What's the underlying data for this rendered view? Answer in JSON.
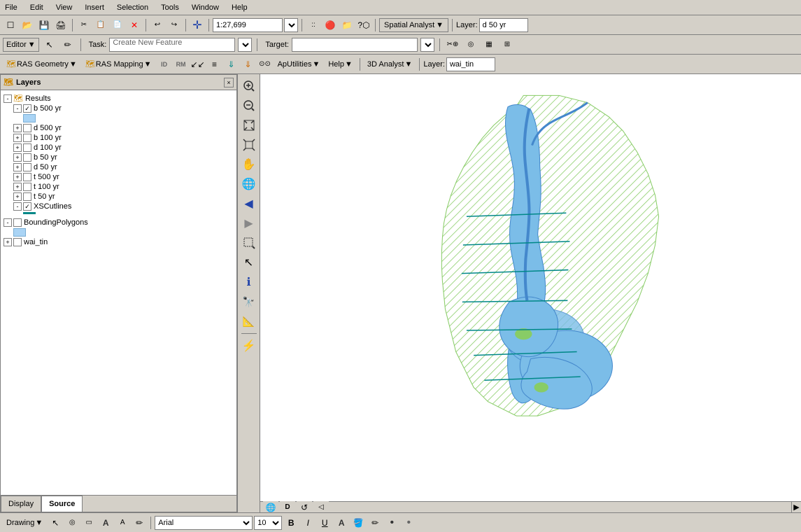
{
  "menubar": {
    "items": [
      "File",
      "Edit",
      "View",
      "Insert",
      "Selection",
      "Tools",
      "Window",
      "Help"
    ]
  },
  "toolbar1": {
    "scale": "1:27,699",
    "spatial_analyst": "Spatial Analyst",
    "layer_label": "Layer:",
    "layer_value": "d 50 yr"
  },
  "toolbar2": {
    "editor_label": "Editor",
    "task_label": "Task:",
    "task_value": "Create New Feature",
    "target_label": "Target:"
  },
  "ras_toolbar": {
    "ras_geometry": "RAS Geometry",
    "ras_mapping": "RAS Mapping",
    "ap_utilities": "ApUtilities",
    "help": "Help",
    "analyst_3d": "3D Analyst",
    "layer_label": "Layer:",
    "layer_value": "wai_tin"
  },
  "layers_panel": {
    "title": "Layers",
    "close_label": "×",
    "groups": [
      {
        "name": "Results",
        "expanded": true,
        "children": [
          {
            "name": "b 500 yr",
            "checked": true,
            "expanded": true,
            "swatch_color": "#aad4f5",
            "indent": 1
          },
          {
            "name": "d 500 yr",
            "checked": false,
            "expanded": false,
            "indent": 1
          },
          {
            "name": "b 100 yr",
            "checked": false,
            "expanded": false,
            "indent": 1
          },
          {
            "name": "d 100 yr",
            "checked": false,
            "expanded": false,
            "indent": 1
          },
          {
            "name": "b 50 yr",
            "checked": false,
            "expanded": false,
            "indent": 1
          },
          {
            "name": "d 50 yr",
            "checked": false,
            "expanded": false,
            "indent": 1
          },
          {
            "name": "t 500 yr",
            "checked": false,
            "expanded": false,
            "indent": 1
          },
          {
            "name": "t 100 yr",
            "checked": false,
            "expanded": false,
            "indent": 1
          },
          {
            "name": "t 50 yr",
            "checked": false,
            "expanded": false,
            "indent": 1
          },
          {
            "name": "XSCutlines",
            "checked": true,
            "expanded": true,
            "line_color": "#008888",
            "indent": 1
          }
        ]
      },
      {
        "name": "BoundingPolygons",
        "expanded": true,
        "checked": false,
        "swatch_color": "#aad4f5",
        "indent": 0
      },
      {
        "name": "wai_tin",
        "checked": false,
        "expanded": false,
        "indent": 0
      }
    ],
    "tabs": [
      "Display",
      "Source"
    ],
    "active_tab": "Source"
  },
  "vertical_toolbar": {
    "buttons": [
      {
        "icon": "⊕",
        "name": "zoom-in"
      },
      {
        "icon": "⊖",
        "name": "zoom-out"
      },
      {
        "icon": "⤢",
        "name": "zoom-full-extent"
      },
      {
        "icon": "⤡",
        "name": "zoom-layer-extent"
      },
      {
        "icon": "✋",
        "name": "pan"
      },
      {
        "icon": "🌐",
        "name": "globe"
      },
      {
        "icon": "◀",
        "name": "back"
      },
      {
        "icon": "▶",
        "name": "forward"
      },
      {
        "icon": "🔲",
        "name": "select-features"
      },
      {
        "icon": "↖",
        "name": "select-pointer"
      },
      {
        "icon": "ℹ",
        "name": "identify"
      },
      {
        "icon": "🔭",
        "name": "hyperlink"
      },
      {
        "icon": "📏",
        "name": "measure"
      },
      {
        "icon": "⚡",
        "name": "lightning"
      }
    ]
  },
  "status_bar": {
    "coords": "",
    "scroll_btns": [
      "◉",
      "D",
      "↺",
      "◁"
    ]
  },
  "drawing_toolbar": {
    "drawing_label": "Drawing",
    "font_name": "Arial",
    "font_size": "10",
    "bold": "B",
    "italic": "I",
    "underline": "U"
  },
  "map": {
    "background": "#f0f0f0",
    "has_hatching": true
  }
}
